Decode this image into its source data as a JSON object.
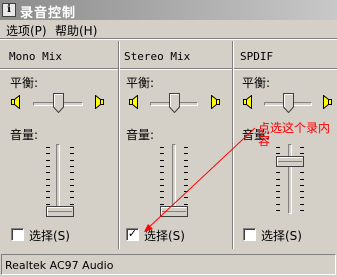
{
  "window": {
    "title": "录音控制",
    "app_icon": "info-icon"
  },
  "menu": {
    "items": [
      {
        "label": "选项(P)"
      },
      {
        "label": "帮助(H)"
      }
    ]
  },
  "channels": [
    {
      "title": "Mono Mix",
      "balance_label": "平衡:",
      "volume_label": "音量:",
      "balance": 0.5,
      "volume": 0.0,
      "select_label": "选择(S)",
      "selected": false
    },
    {
      "title": "Stereo Mix",
      "balance_label": "平衡:",
      "volume_label": "音量:",
      "balance": 0.5,
      "volume": 0.0,
      "select_label": "选择(S)",
      "selected": true
    },
    {
      "title": "SPDIF",
      "balance_label": "平衡:",
      "volume_label": "音量:",
      "balance": 0.5,
      "volume": 0.78,
      "select_label": "选择(S)",
      "selected": false
    }
  ],
  "annotation": {
    "text": "点选这个录内容",
    "color": "#ff0000"
  },
  "status": {
    "text": "Realtek AC97 Audio"
  }
}
